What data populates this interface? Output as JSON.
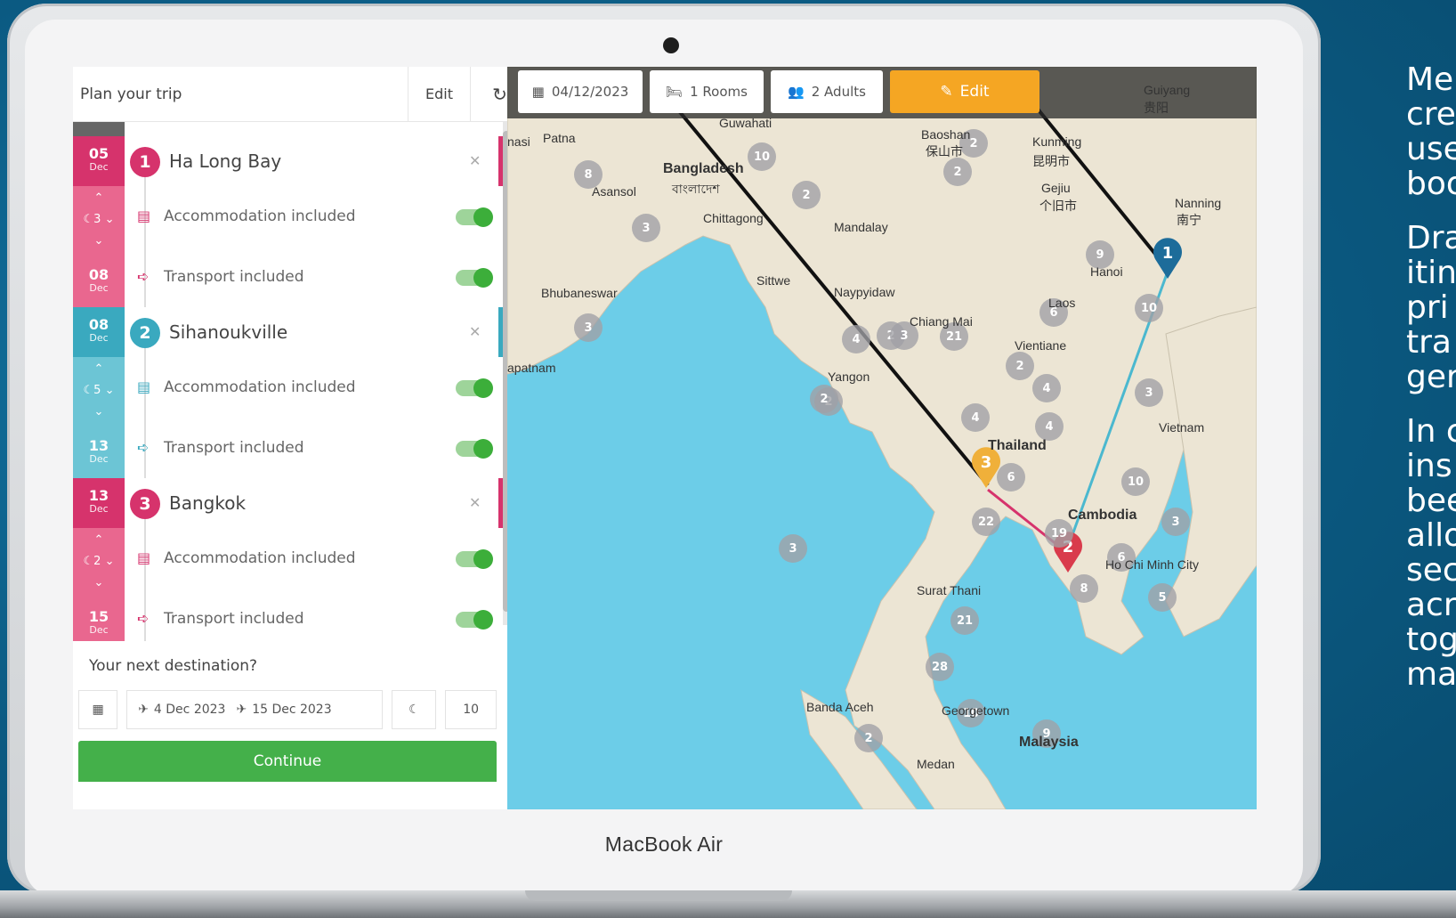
{
  "side_text": [
    "Me",
    "cre",
    "use",
    "boo",
    "Dra",
    "itin",
    "pri",
    "tra",
    "ger",
    "In c",
    "ins",
    "bee",
    "allo",
    "sec",
    "acr",
    "tog",
    "ma"
  ],
  "laptop": {
    "brand": "MacBook Air"
  },
  "panel": {
    "title": "Plan your trip",
    "edit_label": "Edit",
    "refresh_icon": "refresh-icon",
    "stops": [
      {
        "num": "1",
        "name": "Ha Long Bay",
        "start_day": "05",
        "start_month": "Dec",
        "nights": "3",
        "end_day": "08",
        "end_month": "Dec",
        "accommodation": "Accommodation included",
        "transport": "Transport included",
        "color": "#d6336c",
        "light": "#e9678f"
      },
      {
        "num": "2",
        "name": "Sihanoukville",
        "start_day": "08",
        "start_month": "Dec",
        "nights": "5",
        "end_day": "13",
        "end_month": "Dec",
        "accommodation": "Accommodation included",
        "transport": "Transport included",
        "color": "#3aa9bf",
        "light": "#6cc5d5"
      },
      {
        "num": "3",
        "name": "Bangkok",
        "start_day": "13",
        "start_month": "Dec",
        "nights": "2",
        "end_day": "15",
        "end_month": "Dec",
        "accommodation": "Accommodation included",
        "transport": "Transport included",
        "color": "#d6336c",
        "light": "#e9678f"
      }
    ],
    "next_destination_label": "Your next destination?",
    "date_from": "4 Dec 2023",
    "date_to": "15 Dec 2023",
    "nights_value": "10",
    "continue_label": "Continue"
  },
  "map": {
    "date": "04/12/2023",
    "rooms": "1 Rooms",
    "adults": "2 Adults",
    "edit_label": "Edit",
    "accent": "#f5a623",
    "labels": [
      "Patna",
      "Guwahati",
      "Baoshan",
      "保山市",
      "Guiyang",
      "贵阳",
      "Kunming",
      "昆明市",
      "Gejiu",
      "个旧市",
      "Nanning",
      "南宁",
      "Asansol",
      "Bangladesh",
      "বাংলাদেশ",
      "Chittagong",
      "Mandalay",
      "Bhubaneswar",
      "Sittwe",
      "Naypyidaw",
      "Hanoi",
      "Laos",
      "Chiang Mai",
      "Vientiane",
      "Yangon",
      "Vietnam",
      "Thailand",
      "Cambodia",
      "Ho Chi Minh City",
      "Surat Thani",
      "Banda Aceh",
      "Georgetown",
      "Malaysia",
      "Medan",
      "apatnam",
      "nasi"
    ],
    "clusters": [
      "10",
      "8",
      "2",
      "3",
      "2",
      "2",
      "4",
      "2",
      "9",
      "10",
      "3",
      "3",
      "4",
      "6",
      "21",
      "2",
      "4",
      "4",
      "3",
      "6",
      "10",
      "2",
      "3",
      "22",
      "19",
      "6",
      "5",
      "8",
      "3",
      "21",
      "28",
      "10",
      "9",
      "2",
      "2"
    ]
  }
}
